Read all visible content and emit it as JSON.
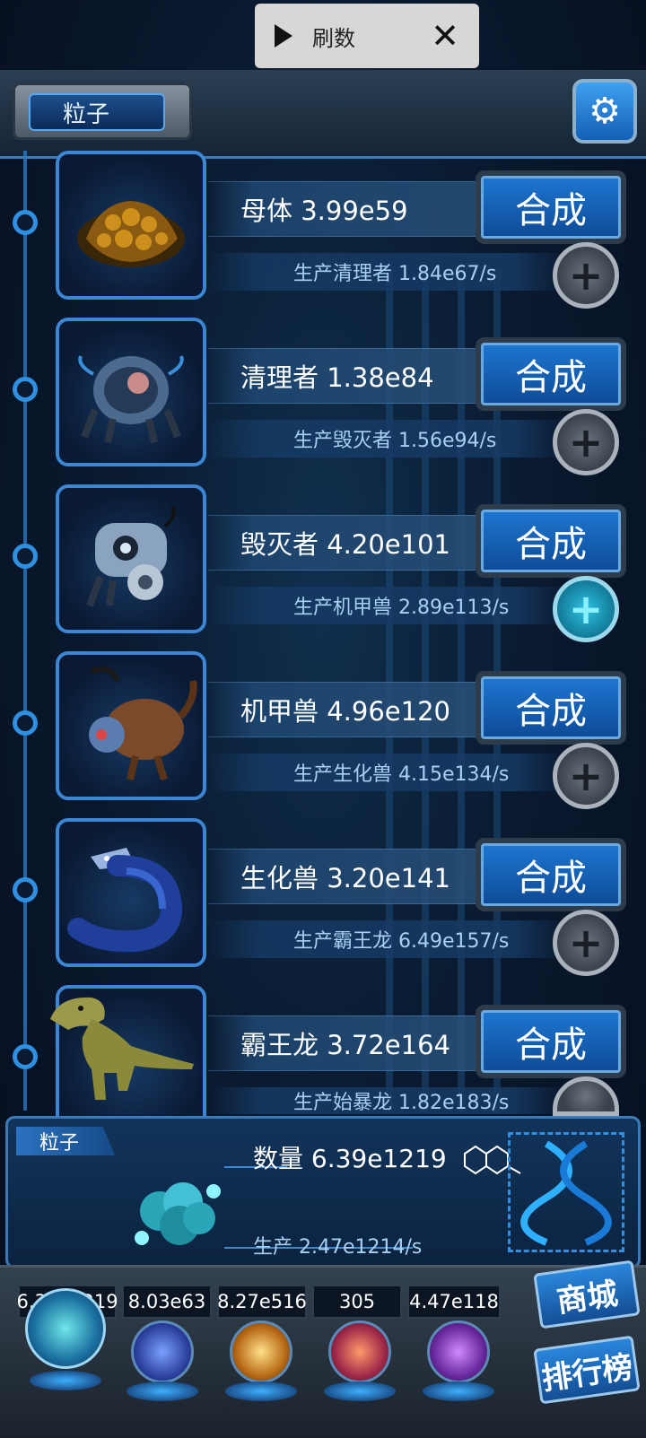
{
  "overlay": {
    "title": "刷数"
  },
  "header": {
    "tab_label": "粒子"
  },
  "rows": [
    {
      "name": "母体 3.99e59",
      "combine": "合成",
      "production": "生产清理者 1.84e67/s",
      "active": false
    },
    {
      "name": "清理者 1.38e84",
      "combine": "合成",
      "production": "生产毁灭者 1.56e94/s",
      "active": false
    },
    {
      "name": "毁灭者 4.20e101",
      "combine": "合成",
      "production": "生产机甲兽 2.89e113/s",
      "active": true
    },
    {
      "name": "机甲兽 4.96e120",
      "combine": "合成",
      "production": "生产生化兽 4.15e134/s",
      "active": false
    },
    {
      "name": "生化兽 3.20e141",
      "combine": "合成",
      "production": "生产霸王龙 6.49e157/s",
      "active": false
    },
    {
      "name": "霸王龙 3.72e164",
      "combine": "合成",
      "production": "生产始暴龙 1.82e183/s",
      "active": false
    }
  ],
  "info": {
    "label": "粒子",
    "quantity": "数量 6.39e1219",
    "production": "生产 2.47e1214/s"
  },
  "resources": [
    "6.39e1219",
    "8.03e63",
    "8.27e516",
    "305",
    "4.47e118"
  ],
  "side_buttons": {
    "shop": "商城",
    "ranking": "排行榜"
  },
  "colors": {
    "accent": "#1d75d0",
    "panel": "#12345a",
    "highlight": "#2fc0e0"
  }
}
